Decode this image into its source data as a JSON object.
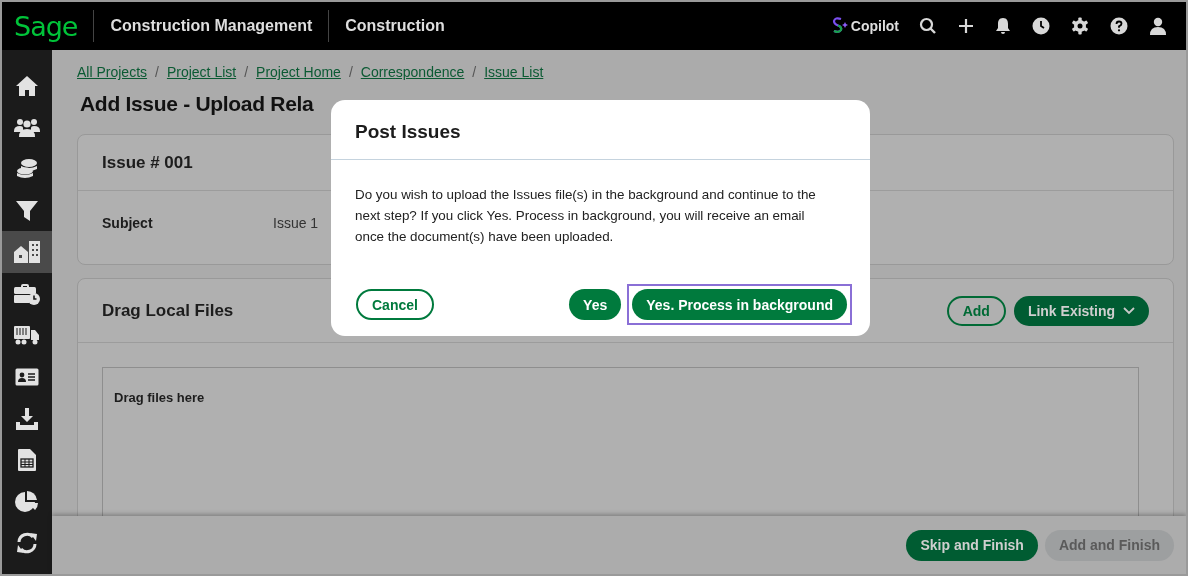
{
  "app": {
    "logo": "Sage",
    "product": "Construction Management",
    "module": "Construction",
    "copilot": "Copilot"
  },
  "sidebar": {
    "items": [
      {
        "selected": false
      },
      {
        "selected": false
      },
      {
        "selected": false
      },
      {
        "selected": false
      },
      {
        "selected": true
      },
      {
        "selected": false
      },
      {
        "selected": false
      },
      {
        "selected": false
      },
      {
        "selected": false
      },
      {
        "selected": false
      },
      {
        "selected": false
      },
      {
        "selected": false
      }
    ]
  },
  "breadcrumbs": [
    {
      "label": "All Projects",
      "separator": "/"
    },
    {
      "label": "Project List",
      "separator": "/"
    },
    {
      "label": "Project Home",
      "separator": "/"
    },
    {
      "label": "Correspondence",
      "separator": "/"
    },
    {
      "label": "Issue List"
    }
  ],
  "page_title": "Add Issue - Upload Rela",
  "issue_card": {
    "title": "Issue # 001",
    "fields": [
      {
        "label": "Subject",
        "value": "Issue 1"
      }
    ]
  },
  "files_card": {
    "title": "Drag Local Files",
    "buttons": [
      {
        "label": "Add",
        "kind": "outline"
      },
      {
        "label": "Link Existing",
        "kind": "dropdown"
      }
    ],
    "drop_zone": "Drag files here"
  },
  "footer": {
    "buttons": [
      {
        "label": "Skip and Finish",
        "disabled": false
      },
      {
        "label": "Add and Finish",
        "disabled": true
      }
    ]
  },
  "dialog": {
    "title": "Post Issues",
    "message": "Do you wish to upload the Issues file(s) in the background and continue to the next step? If you click Yes. Process in background, you will receive an email once the document(s) have been uploaded.",
    "buttons": [
      {
        "label": "Cancel",
        "kind": "outline",
        "focused": false
      },
      {
        "label": "Yes",
        "kind": "primary",
        "focused": false
      },
      {
        "label": "Yes. Process in background",
        "kind": "primary",
        "focused": true
      }
    ]
  }
}
